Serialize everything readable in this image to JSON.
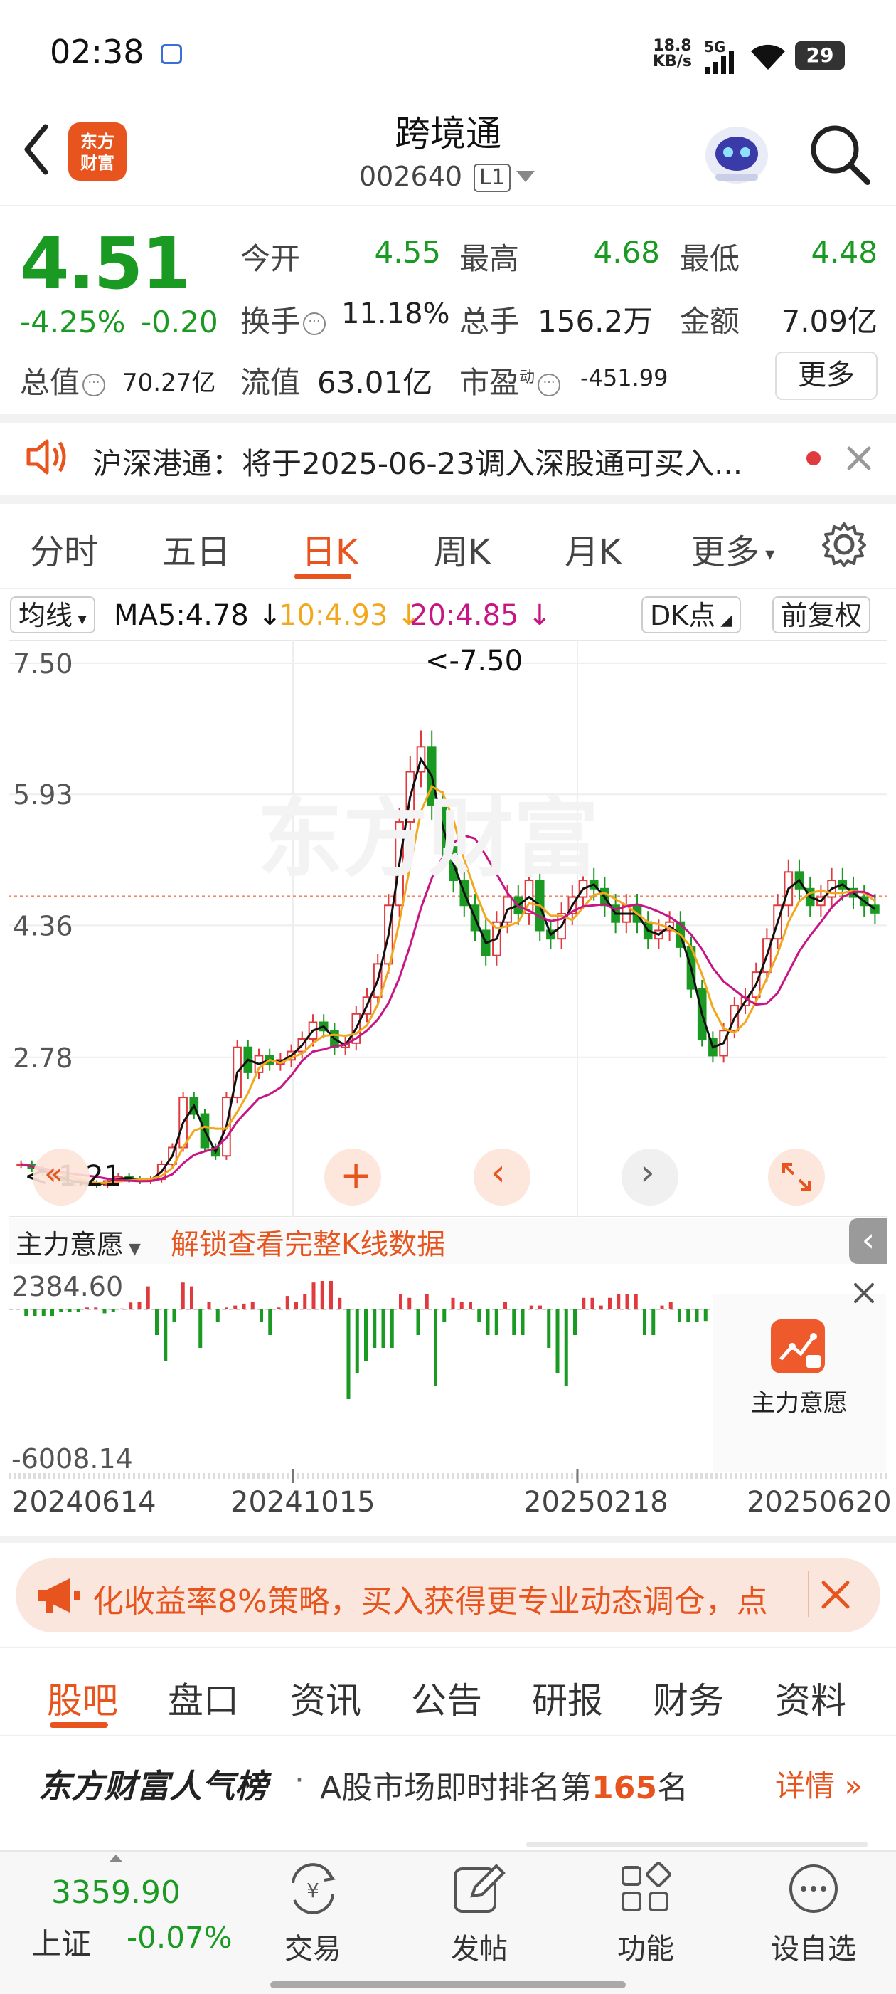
{
  "status_bar": {
    "time": "02:38",
    "net_speed": "18.8",
    "net_unit": "KB/s",
    "signal": "5G",
    "battery": "29"
  },
  "header": {
    "title": "跨境通",
    "code": "002640",
    "level": "L1",
    "logo_line1": "东方",
    "logo_line2": "财富"
  },
  "quote": {
    "price": "4.51",
    "change_pct": "-4.25%",
    "change": "-0.20",
    "open_label": "今开",
    "open": "4.55",
    "high_label": "最高",
    "high": "4.68",
    "low_label": "最低",
    "low": "4.48",
    "turnover_label": "换手",
    "turnover": "11.18%",
    "volume_label": "总手",
    "volume": "156.2万",
    "amount_label": "金额",
    "amount": "7.09亿",
    "mktcap_label": "总值",
    "mktcap": "70.27亿",
    "float_label": "流值",
    "float_cap": "63.01亿",
    "pe_label": "市盈",
    "pe_sup": "动",
    "pe": "-451.99",
    "more_label": "更多"
  },
  "notice": {
    "text": "沪深港通：将于2025-06-23调入深股通可买入..."
  },
  "chart_tabs": [
    "分时",
    "五日",
    "日K",
    "周K",
    "月K",
    "更多"
  ],
  "ma_bar": {
    "selector": "均线",
    "ma5": "MA5:4.78",
    "ma10": "10:4.93",
    "ma20": "20:4.85",
    "dk": "DK点",
    "adjust": "前复权"
  },
  "colors": {
    "accent": "#e8541e",
    "down": "#1a9a22",
    "up": "#e0393e",
    "ma5": "#111111",
    "ma10": "#f2a81d",
    "ma20": "#c71585"
  },
  "chart_data": {
    "type": "candlestick",
    "y_ticks": [
      "7.50",
      "5.93",
      "4.36",
      "2.78"
    ],
    "y_range": [
      1.21,
      7.5
    ],
    "max_label": "<-7.50",
    "min_label": "<-1.21",
    "reference_price": 4.71,
    "ma_series": [
      {
        "name": "MA5",
        "color": "#111111"
      },
      {
        "name": "MA10",
        "color": "#f2a81d"
      },
      {
        "name": "MA20",
        "color": "#c71585"
      }
    ],
    "close_path": [
      1.5,
      1.45,
      1.4,
      1.35,
      1.3,
      1.28,
      1.27,
      1.25,
      1.3,
      1.35,
      1.32,
      1.3,
      1.32,
      1.5,
      1.7,
      2.3,
      2.1,
      1.7,
      1.6,
      2.3,
      2.9,
      2.6,
      2.8,
      2.7,
      2.75,
      2.85,
      3.0,
      3.2,
      3.1,
      2.9,
      2.95,
      3.3,
      3.5,
      3.9,
      4.6,
      5.6,
      6.2,
      6.5,
      5.8,
      5.3,
      4.9,
      4.6,
      4.3,
      4.0,
      4.4,
      4.7,
      4.5,
      4.9,
      4.3,
      4.2,
      4.5,
      4.7,
      4.9,
      4.8,
      4.6,
      4.4,
      4.6,
      4.4,
      4.2,
      4.3,
      4.4,
      4.1,
      3.6,
      3.0,
      2.8,
      3.1,
      3.4,
      3.5,
      3.8,
      4.2,
      4.6,
      5.0,
      4.8,
      4.6,
      4.7,
      4.9,
      4.8,
      4.7,
      4.6,
      4.51
    ],
    "indicator": {
      "name": "主力意愿",
      "link": "解锁查看完整K线数据",
      "max": "2384.60",
      "min": "-6008.14"
    },
    "x_labels": [
      "20240614",
      "20241015",
      "20250218",
      "20250620"
    ]
  },
  "indicator_panel": {
    "locked_label": "主力意愿"
  },
  "promo": {
    "text": "化收益率8%策略，买入获得更专业动态调仓，点"
  },
  "bottom_tabs": [
    "股吧",
    "盘口",
    "资讯",
    "公告",
    "研报",
    "财务",
    "资料"
  ],
  "ranking": {
    "brand": "东方财富人气榜",
    "dot": "·",
    "prefix": "A股市场即时排名第",
    "rank": "165",
    "suffix": "名",
    "detail": "详情"
  },
  "index": {
    "value": "3359.90",
    "name": "上证",
    "change": "-0.07%"
  },
  "nav": [
    {
      "label": "交易",
      "icon": "trade-icon"
    },
    {
      "label": "发帖",
      "icon": "post-icon"
    },
    {
      "label": "功能",
      "icon": "apps-icon"
    },
    {
      "label": "设自选",
      "icon": "watchlist-icon"
    }
  ]
}
